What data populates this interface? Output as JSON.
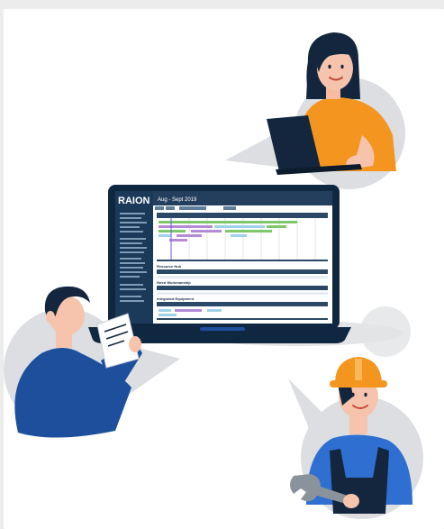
{
  "screen": {
    "logo": "RAION",
    "page_title": "Aug - Sept 2019",
    "section_labels": [
      "Resource Hub",
      "Hired Workmanship",
      "Integrated Equipment"
    ]
  },
  "colors": {
    "navy": "#15304b",
    "blue": "#1d4f9c",
    "orange": "#f4951f",
    "green": "#7fc86a",
    "gray_blob": "#d9dbde"
  },
  "icons": [
    "laptop-icon",
    "document-icon",
    "wrench-icon",
    "hard-hat-icon"
  ]
}
